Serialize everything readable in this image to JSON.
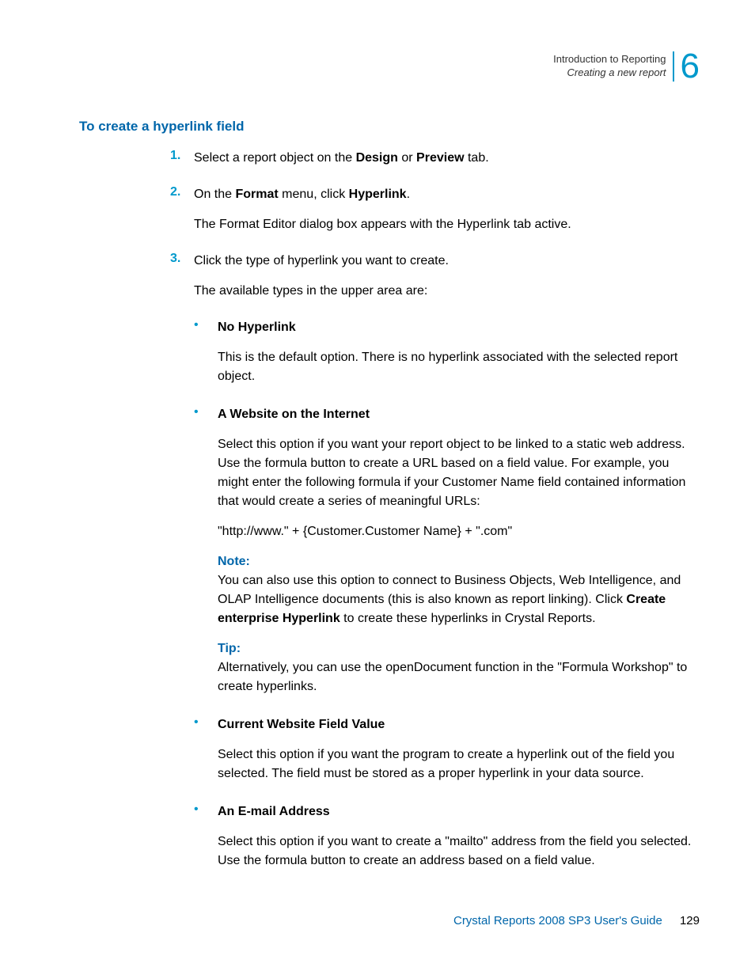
{
  "header": {
    "chapter_line": "Introduction to Reporting",
    "section_line": "Creating a new report",
    "chapter_number": "6"
  },
  "title": "To create a hyperlink field",
  "steps": {
    "s1": {
      "marker": "1.",
      "text_a": "Select a report object on the ",
      "bold_a": "Design",
      "text_b": " or ",
      "bold_b": "Preview",
      "text_c": " tab."
    },
    "s2": {
      "marker": "2.",
      "text_a": "On the ",
      "bold_a": "Format",
      "text_b": " menu, click ",
      "bold_b": "Hyperlink",
      "text_c": ".",
      "para_after": "The Format Editor dialog box appears with the Hyperlink tab active."
    },
    "s3": {
      "marker": "3.",
      "text": "Click the type of hyperlink you want to create.",
      "para_after": "The available types in the upper area are:"
    }
  },
  "bullets": {
    "no_hyperlink": {
      "title": "No Hyperlink",
      "body": "This is the default option. There is no hyperlink associated with the selected report object."
    },
    "website": {
      "title": "A Website on the Internet",
      "body": "Select this option if you want your report object to be linked to a static web address. Use the formula button to create a URL based on a field value. For example, you might enter the following formula if your Customer Name field contained information that would create a series of meaningful URLs:",
      "code": "\"http://www.\" + {Customer.Customer Name} + \".com\"",
      "note_label": "Note:",
      "note_a": "You can also use this option to connect to Business Objects, Web Intelligence, and OLAP Intelligence documents (this is also known as report linking). Click ",
      "note_bold": "Create enterprise Hyperlink",
      "note_b": " to create these hyperlinks in Crystal Reports.",
      "tip_label": "Tip:",
      "tip": "Alternatively, you can use the openDocument function in the \"Formula Workshop\" to create hyperlinks."
    },
    "current_field": {
      "title": "Current Website Field Value",
      "body": "Select this option if you want the program to create a hyperlink out of the field you selected. The field must be stored as a proper hyperlink in your data source."
    },
    "email": {
      "title": "An E-mail Address",
      "body": "Select this option if you want to create a \"mailto\" address from the field you selected. Use the formula button to create an address based on a field value."
    }
  },
  "bullet_marker": "•",
  "footer": {
    "guide": "Crystal Reports 2008 SP3 User's Guide",
    "page": "129"
  }
}
